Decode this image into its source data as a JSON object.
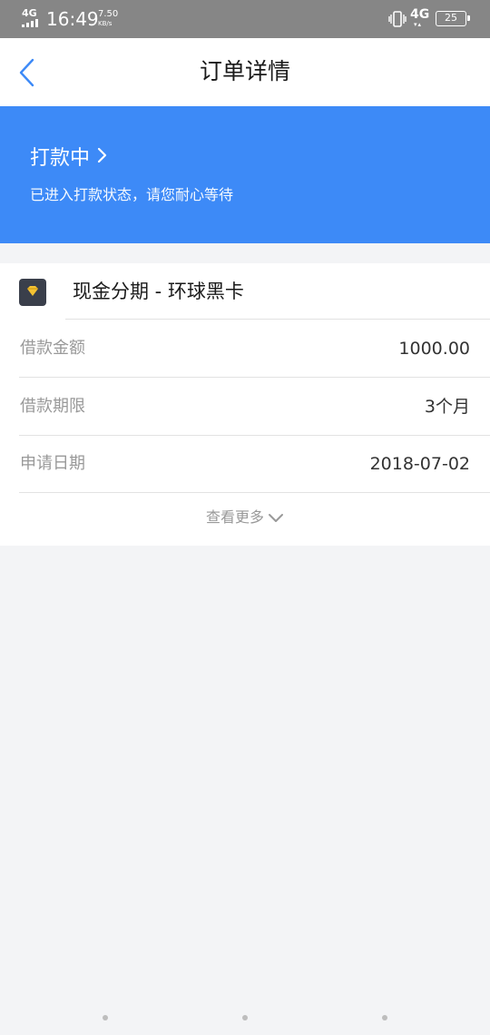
{
  "status_bar": {
    "network_left": "4G",
    "time": "16:49",
    "speed_value": "7.50",
    "speed_unit": "KB/s",
    "network_right": "4G",
    "battery": "25"
  },
  "navbar": {
    "title": "订单详情",
    "back_icon": "chevron-left-icon"
  },
  "banner": {
    "status": "打款中",
    "description": "已进入打款状态，请您耐心等待",
    "background_color": "#3d8af7"
  },
  "product": {
    "icon": "diamond-icon",
    "name": "现金分期 - 环球黑卡"
  },
  "details": [
    {
      "label": "借款金额",
      "value": "1000.00"
    },
    {
      "label": "借款期限",
      "value": "3个月"
    },
    {
      "label": "申请日期",
      "value": "2018-07-02"
    }
  ],
  "more": {
    "label": "查看更多",
    "icon": "chevron-down-icon"
  },
  "colors": {
    "accent": "#3d8af7",
    "page_background": "#f3f4f6",
    "label_gray": "#999999",
    "diamond_gold": "#f5c232"
  }
}
